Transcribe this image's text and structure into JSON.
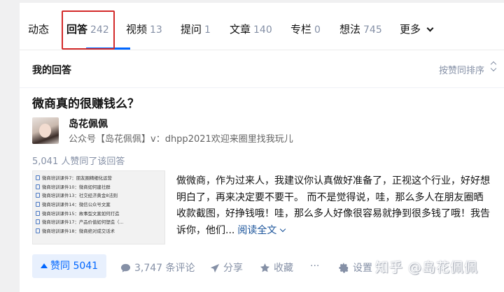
{
  "tabs": [
    {
      "label": "动态",
      "count": ""
    },
    {
      "label": "回答",
      "count": "242"
    },
    {
      "label": "视频",
      "count": "13"
    },
    {
      "label": "提问",
      "count": "1"
    },
    {
      "label": "文章",
      "count": "140"
    },
    {
      "label": "专栏",
      "count": "0"
    },
    {
      "label": "想法",
      "count": "745"
    },
    {
      "label": "更多",
      "count": ""
    }
  ],
  "subheader": {
    "title": "我的回答",
    "sort_label": "按赞同排序"
  },
  "answer": {
    "question": "微商真的很赚钱么？",
    "author_name": "岛花佩佩",
    "author_bio": "公众号【岛花佩佩】v：dhpp2021欢迎来圈里找我玩儿",
    "votes_text": "5,041 人赞同了该回答",
    "excerpt": "做微商，作为过来人，我建议你认真做好准备了，正视这个行业，好好想明白了，再来决定要不要干。 而不是觉得说，哇，那么多人在朋友圈晒收款截图，好挣钱哦！哇，那么多人好像很容易就挣到很多钱了哦！我告诉你，他们...",
    "read_more": "阅读全文",
    "thumb_lines": [
      "微商培训课件7：朋友圈精细化运营",
      "微商培训课件10：微商如何建社群",
      "微商培训课件13：社交经济黄金8法则",
      "微商培训课件14：微信公众号文案",
      "微商培训课件15：故事型文案如何打造",
      "微商培训课件17：产品价值如何塑造（...",
      "微商培训课件18：微商绝对成交话术"
    ]
  },
  "actions": {
    "vote": "赞同 5041",
    "comments": "3,747 条评论",
    "share": "分享",
    "collect": "收藏",
    "more": "···",
    "settings": "设置"
  },
  "watermark": "知乎 @岛花佩佩",
  "colors": {
    "accent": "#0066ff",
    "highlight": "#d32a2a",
    "muted": "#8590a6"
  }
}
